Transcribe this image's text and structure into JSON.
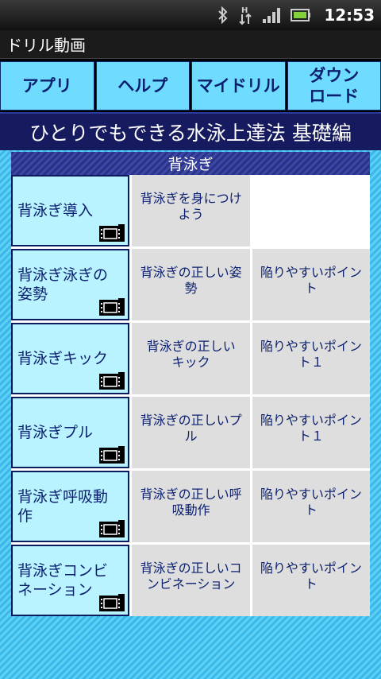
{
  "status": {
    "time": "12:53"
  },
  "app": {
    "title": "ドリル動画"
  },
  "nav": [
    {
      "label": "アプリ"
    },
    {
      "label": "ヘルプ"
    },
    {
      "label": "マイドリル"
    },
    {
      "label": "ダウン\nロード"
    }
  ],
  "course": {
    "title": "ひとりでもできる水泳上達法 基礎編"
  },
  "section": {
    "title": "背泳ぎ"
  },
  "rows": [
    {
      "main": "背泳ぎ導入",
      "sub1": "背泳ぎを身につけ\nよう",
      "sub2": ""
    },
    {
      "main": "背泳ぎ泳ぎの\n姿勢",
      "sub1": "背泳ぎの正しい姿\n勢",
      "sub2": "陥りやすいポイン\nト"
    },
    {
      "main": "背泳ぎキック",
      "sub1": "背泳ぎの正しい\nキック",
      "sub2": "陥りやすいポイン\nト１"
    },
    {
      "main": "背泳ぎプル",
      "sub1": "背泳ぎの正しいプ\nル",
      "sub2": "陥りやすいポイン\nト１"
    },
    {
      "main": "背泳ぎ呼吸動\n作",
      "sub1": "背泳ぎの正しい呼\n吸動作",
      "sub2": "陥りやすいポイン\nト"
    },
    {
      "main": "背泳ぎコンビ\nネーション",
      "sub1": "背泳ぎの正しいコ\nンビネーション",
      "sub2": "陥りやすいポイン\nト"
    }
  ],
  "icons": {
    "status": [
      "bluetooth-icon",
      "data-transfer-icon",
      "signal-icon",
      "battery-icon"
    ],
    "row": "film-icon"
  },
  "colors": {
    "nav_bg": "#6fdcff",
    "nav_text": "#0b1f6e",
    "header_bg": "#151b5e",
    "cell_main_bg": "#b9f3ff",
    "cell_sub_bg": "#dedede"
  }
}
